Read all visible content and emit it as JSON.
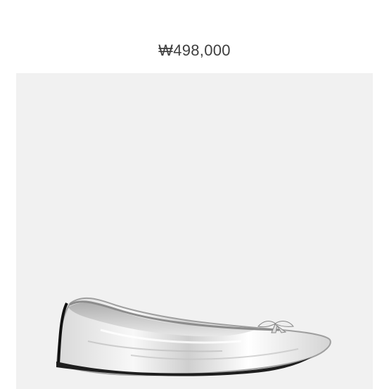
{
  "product": {
    "title_partial": "…",
    "price": "₩498,000",
    "image_icon": "silver-ballet-flat-image"
  },
  "colors": {
    "background": "#ffffff",
    "image_panel": "#f1f1f1",
    "text": "#3f3f3f"
  }
}
